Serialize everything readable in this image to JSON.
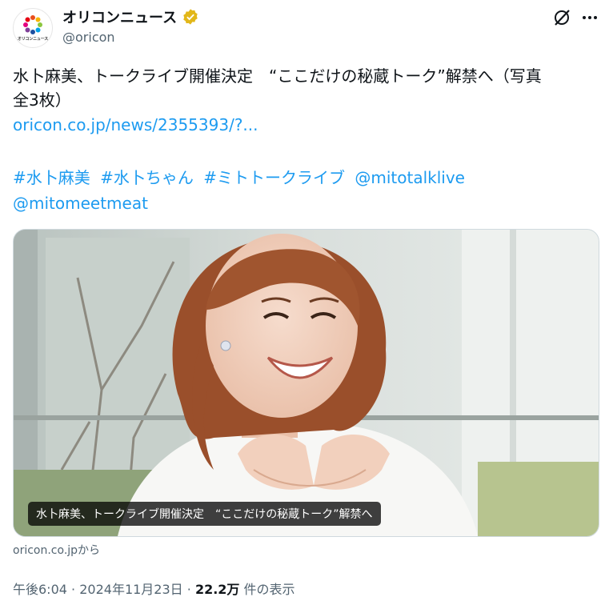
{
  "account": {
    "display_name": "オリコンニュース",
    "handle": "@oricon",
    "avatar_label": "オリコンニュース"
  },
  "tweet": {
    "text_line1": "水卜麻美、トークライブ開催決定　“ここだけの秘蔵トーク”解禁へ（写真",
    "text_line2": "全3枚）",
    "link": "oricon.co.jp/news/2355393/?...",
    "hashtags": [
      "#水卜麻美",
      "#水卜ちゃん",
      "#ミトトークライブ",
      "@mitotalklive"
    ],
    "mention2": "@mitomeetmeat"
  },
  "media": {
    "caption": "水卜麻美、トークライブ開催決定　“ここだけの秘蔵トーク”解禁へ"
  },
  "card_source": "oricon.co.jpから",
  "meta": {
    "time": "午後6:04",
    "sep": "·",
    "date": "2024年11月23日",
    "views": "22.2万",
    "views_suffix": "件の表示"
  },
  "colors": {
    "link": "#1d9bf0",
    "text": "#0f1419",
    "secondary": "#536471",
    "verified": "#e2b719"
  }
}
